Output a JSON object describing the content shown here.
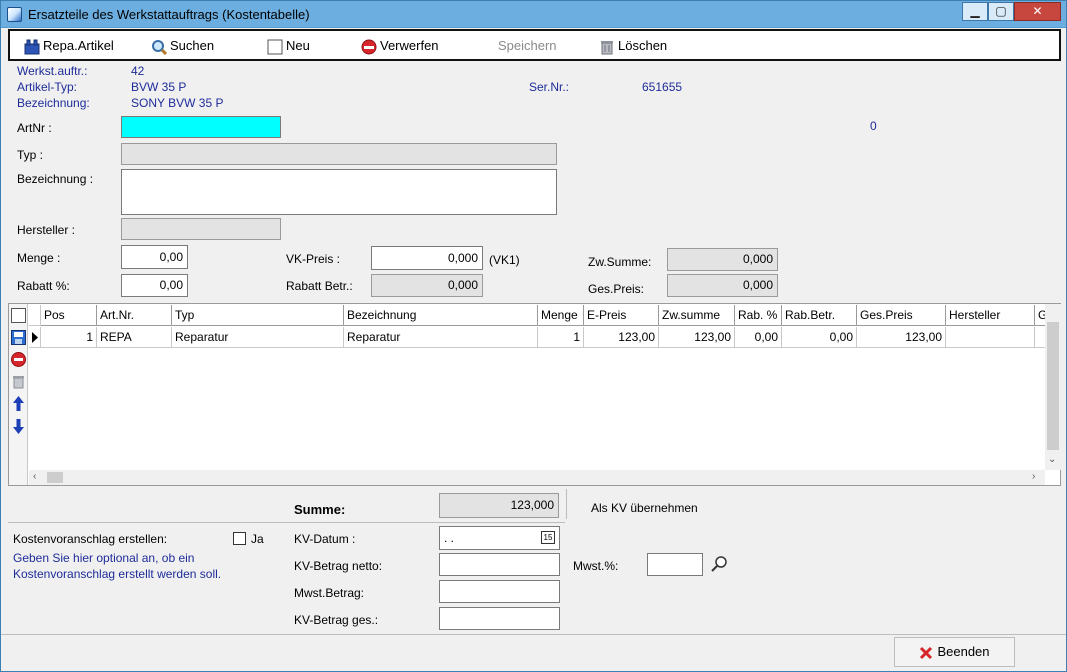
{
  "window": {
    "title": "Ersatzteile des Werkstattauftrags (Kostentabelle)",
    "min": "▁",
    "max": "▢",
    "close": "✕"
  },
  "toolbar": {
    "repa_artikel": "Repa.Artikel",
    "suchen": "Suchen",
    "neu": "Neu",
    "verwerfen": "Verwerfen",
    "speichern": "Speichern",
    "loeschen": "Löschen"
  },
  "info": {
    "werkst_auftr_label": "Werkst.auftr.:",
    "werkst_auftr_value": "42",
    "artikel_typ_label": "Artikel-Typ:",
    "artikel_typ_value": "BVW 35 P",
    "bezeichnung_label": "Bezeichnung:",
    "bezeichnung_value": "SONY BVW 35 P",
    "ser_nr_label": "Ser.Nr.:",
    "ser_nr_value": "651655",
    "counter": "0"
  },
  "form": {
    "artnr_label": "ArtNr :",
    "artnr_value": "",
    "typ_label": "Typ :",
    "typ_value": "",
    "bezeichnung_label": "Bezeichnung :",
    "bezeichnung_value": "",
    "hersteller_label": "Hersteller :",
    "hersteller_value": "",
    "menge_label": "Menge :",
    "menge_value": "0,00",
    "rabatt_label": "Rabatt %:",
    "rabatt_value": "0,00",
    "vk_preis_label": "VK-Preis :",
    "vk_preis_value": "0,000",
    "vk1": "(VK1)",
    "rabatt_betr_label": "Rabatt Betr.:",
    "rabatt_betr_value": "0,000",
    "zw_summe_label": "Zw.Summe:",
    "zw_summe_value": "0,000",
    "ges_preis_label": "Ges.Preis:",
    "ges_preis_value": "0,000"
  },
  "grid": {
    "columns": [
      "Pos",
      "Art.Nr.",
      "Typ",
      "Bezeichnung",
      "Menge",
      "E-Preis",
      "Zw.summe",
      "Rab. %",
      "Rab.Betr.",
      "Ges.Preis",
      "Hersteller",
      "G"
    ],
    "rows": [
      [
        "1",
        "REPA",
        "Reparatur",
        "Reparatur",
        "1",
        "123,00",
        "123,00",
        "0,00",
        "0,00",
        "123,00",
        "",
        ""
      ]
    ]
  },
  "summary": {
    "summe_label": "Summe:",
    "summe_value": "123,000",
    "als_kv": "Als KV übernehmen",
    "kv_erstellen_label": "Kostenvoranschlag erstellen:",
    "ja_label": "Ja",
    "note": "Geben Sie hier optional an, ob ein Kostenvoranschlag erstellt werden soll.",
    "kv_datum_label": "KV-Datum :",
    "kv_datum_value": " .  .",
    "calendar_icon_text": "15",
    "kv_netto_label": "KV-Betrag netto:",
    "kv_netto_value": "",
    "mwst_betrag_label": "Mwst.Betrag:",
    "mwst_betrag_value": "",
    "kv_ges_label": "KV-Betrag ges.:",
    "kv_ges_value": "",
    "mwst_prozent_label": "Mwst.%:",
    "mwst_prozent_value": ""
  },
  "footer": {
    "beenden": "Beenden"
  }
}
